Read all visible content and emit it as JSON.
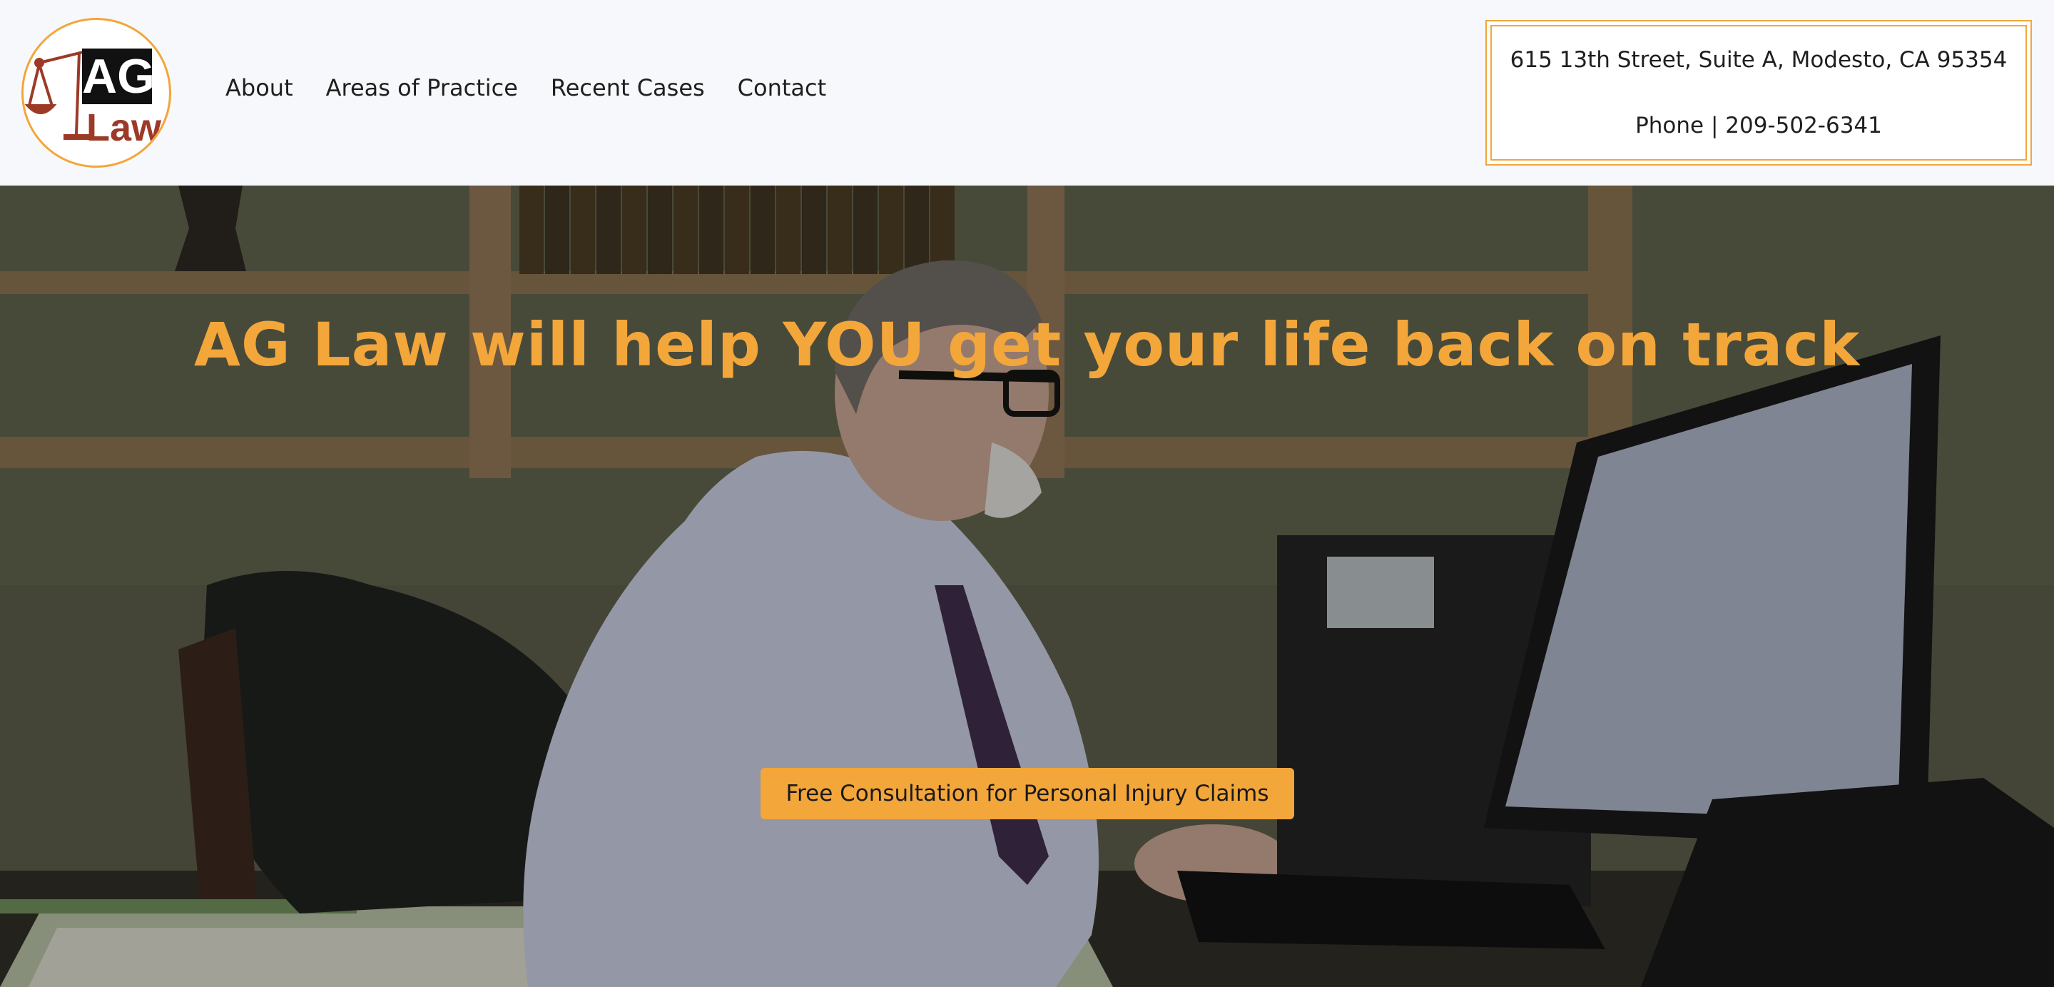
{
  "brand": {
    "logo_letters": "AG",
    "logo_word": "Law",
    "logo_icon": "scales-of-justice-icon",
    "accent_color": "#f3a63a",
    "logo_red": "#9c3a27"
  },
  "nav": {
    "items": [
      {
        "label": "About"
      },
      {
        "label": "Areas of Practice"
      },
      {
        "label": "Recent Cases"
      },
      {
        "label": "Contact"
      }
    ]
  },
  "contact": {
    "address": "615 13th Street, Suite A, Modesto, CA 95354",
    "phone": "Phone | 209-502-6341"
  },
  "hero": {
    "title": "AG Law will help YOU get your life back on track",
    "cta_label": "Free Consultation for Personal Injury Claims"
  }
}
